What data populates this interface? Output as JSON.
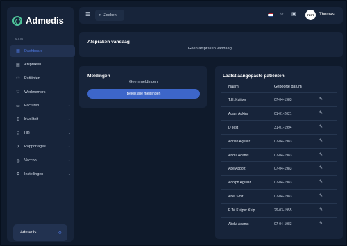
{
  "app": {
    "name": "Admedis"
  },
  "sidebar": {
    "section_label": "MAIN",
    "items": [
      {
        "label": "Dashboard",
        "icon": "▦",
        "icon_name": "dashboard-icon",
        "active": true,
        "has_children": false
      },
      {
        "label": "Afspraken",
        "icon": "▤",
        "icon_name": "calendar-icon",
        "active": false,
        "has_children": false
      },
      {
        "label": "Patiënten",
        "icon": "⚇",
        "icon_name": "users-icon",
        "active": false,
        "has_children": false
      },
      {
        "label": "Werknemers",
        "icon": "♡",
        "icon_name": "heart-icon",
        "active": false,
        "has_children": false
      },
      {
        "label": "Facturen",
        "icon": "▭",
        "icon_name": "invoice-icon",
        "active": false,
        "has_children": true
      },
      {
        "label": "Kwaliteit",
        "icon": "▯",
        "icon_name": "quality-icon",
        "active": false,
        "has_children": true
      },
      {
        "label": "HR",
        "icon": "⚲",
        "icon_name": "person-icon",
        "active": false,
        "has_children": true
      },
      {
        "label": "Rapportages",
        "icon": "↗",
        "icon_name": "chart-icon",
        "active": false,
        "has_children": true
      },
      {
        "label": "Veccoo",
        "icon": "◎",
        "icon_name": "settings-ring-icon",
        "active": false,
        "has_children": true
      },
      {
        "label": "Instellingen",
        "icon": "⚙",
        "icon_name": "gear-icon",
        "active": false,
        "has_children": true
      }
    ],
    "user_card": {
      "label": "Admedis"
    }
  },
  "topbar": {
    "search_label": "Zoeken",
    "avatar_text": "TEST",
    "username": "Thomas"
  },
  "appointments": {
    "title": "Afspraken vandaag",
    "empty_text": "Geen afspraken vandaag"
  },
  "notifications": {
    "title": "Meldingen",
    "empty_text": "Geen meldingen",
    "button_label": "Bekijk alle meldingen"
  },
  "patients": {
    "title": "Laatst aangepaste patiënten",
    "columns": {
      "name": "Naam",
      "dob": "Geboorte datum"
    },
    "rows": [
      {
        "name": "T.H. Kuijper",
        "dob": "07-04-1983"
      },
      {
        "name": "Adam Adkins",
        "dob": "01-01-2021"
      },
      {
        "name": "D Test",
        "dob": "31-01-1994"
      },
      {
        "name": "Adrian Aguilar",
        "dob": "07-04-1983"
      },
      {
        "name": "Abdul Adams",
        "dob": "07-04-1983"
      },
      {
        "name": "Abe Abbott",
        "dob": "07-04-1983"
      },
      {
        "name": "Adolph Aguilar",
        "dob": "07-04-1983"
      },
      {
        "name": "Abel Smit",
        "dob": "07-04-1983"
      },
      {
        "name": "EJM Kuijper Kuip",
        "dob": "29-03-1955"
      },
      {
        "name": "Abdul Adams",
        "dob": "07-04-1983"
      }
    ]
  },
  "colors": {
    "background": "#0f1a2b",
    "panel": "#17243a",
    "accent": "#3d66c9",
    "logo": "#4fc49a"
  }
}
